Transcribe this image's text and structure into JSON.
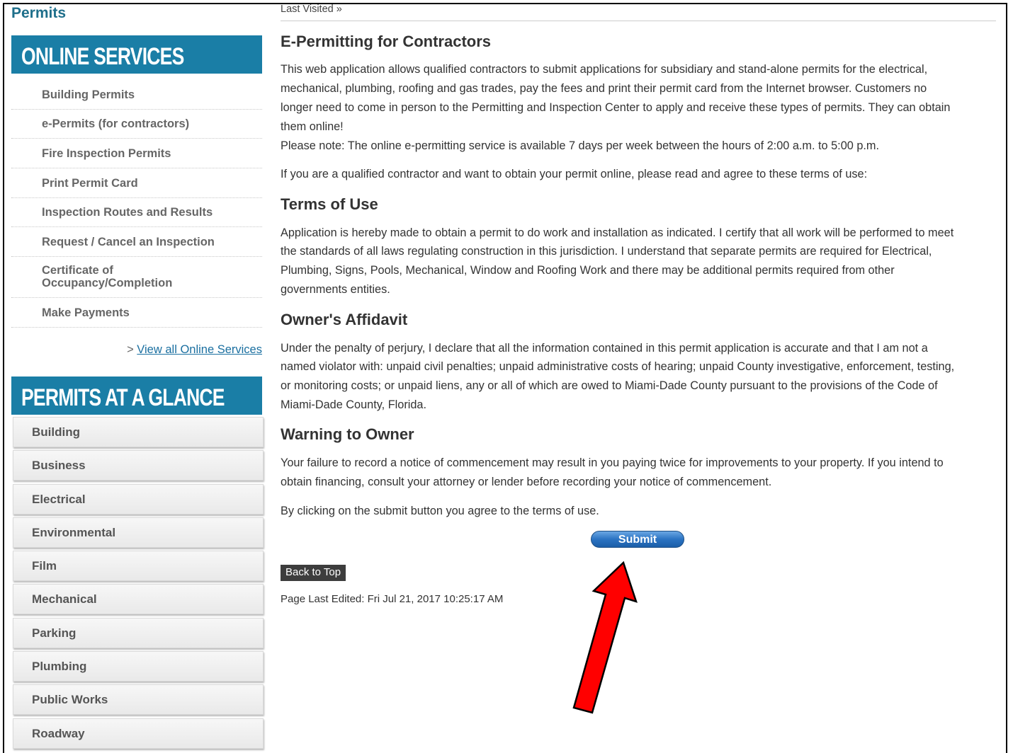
{
  "sidebar": {
    "title": "Permits",
    "online_services_banner": "ONLINE SERVICES",
    "online_services": [
      "Building Permits",
      "e-Permits (for contractors)",
      "Fire Inspection Permits",
      "Print Permit Card",
      "Inspection Routes and Results",
      "Request / Cancel an Inspection",
      "Certificate of",
      "Occupancy/Completion",
      "Make Payments"
    ],
    "view_all_prefix": "> ",
    "view_all_label": "View all Online Services",
    "glance_banner": "PERMITS AT A GLANCE",
    "glance_items": [
      "Building",
      "Business",
      "Electrical",
      "Environmental",
      "Film",
      "Mechanical",
      "Parking",
      "Plumbing",
      "Public Works",
      "Roadway"
    ]
  },
  "main": {
    "last_visited": "Last Visited »",
    "title": "E-Permitting for Contractors",
    "intro_lines": [
      "This web application allows qualified contractors to submit applications for subsidiary and stand-alone permits for the electrical,",
      "mechanical, plumbing, roofing and gas trades, pay the fees and print their permit card from the Internet browser. Customers no",
      "longer need to come in person to the Permitting and Inspection Center to apply and receive these types of permits. They can obtain",
      "them online!",
      "Please note: The online e-permitting service is available 7 days per week between the hours of 2:00 a.m. to 5:00 p.m."
    ],
    "qualify_text": "If you are a qualified contractor and want to obtain your permit online, please read and agree to these terms of use:",
    "terms_heading": "Terms of Use",
    "terms_lines": [
      "Application is hereby made to obtain a permit to do work and installation as indicated. I certify that all work will be performed to meet",
      "the standards of all laws regulating construction in this jurisdiction. I understand that separate permits are required for Electrical,",
      "Plumbing, Signs, Pools, Mechanical, Window and Roofing Work and there may be additional permits required from other",
      "governments entities."
    ],
    "affidavit_heading": "Owner's Affidavit",
    "affidavit_lines": [
      "Under the penalty of perjury, I declare that all the information contained in this permit application is accurate and that I am not a",
      "named violator with: unpaid civil penalties; unpaid administrative costs of hearing; unpaid County investigative, enforcement, testing,",
      "or monitoring costs; or unpaid liens, any or all of which are owed to Miami-Dade County pursuant to the provisions of the Code of",
      "Miami-Dade County, Florida."
    ],
    "warning_heading": "Warning to Owner",
    "warning_lines": [
      "Your failure to record a notice of commencement may result in you paying twice for improvements to your property. If you intend to",
      "obtain financing, consult your attorney or lender before recording your notice of commencement."
    ],
    "agree_text": "By clicking on the submit button you agree to the terms of use.",
    "submit_label": "Submit",
    "back_to_top_label": "Back to Top",
    "last_edited": "Page Last Edited: Fri Jul 21, 2017 10:25:17 AM"
  },
  "colors": {
    "banner": "#1a7ea6",
    "title": "#1f6f8b",
    "link": "#1a6fa0",
    "arrow": "#ff0000"
  }
}
